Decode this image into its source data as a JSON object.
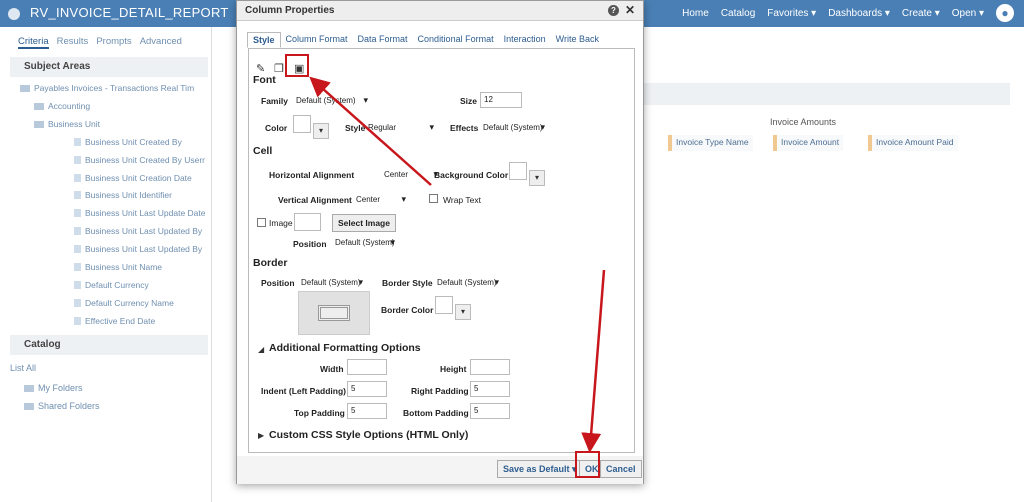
{
  "app": {
    "title": "RV_INVOICE_DETAIL_REPORT"
  },
  "topnav": [
    "Home",
    "Catalog",
    "Favorites ▾",
    "Dashboards ▾",
    "Create ▾",
    "Open ▾"
  ],
  "left": {
    "tabs": [
      "Criteria",
      "Results",
      "Prompts",
      "Advanced"
    ],
    "subject_areas_title": "Subject Areas",
    "root": "Payables Invoices - Transactions Real Tim",
    "folders": [
      "Accounting",
      "Business Unit"
    ],
    "columns": [
      "Business Unit Created By",
      "Business Unit Created By Usernam",
      "Business Unit Creation Date",
      "Business Unit Identifier",
      "Business Unit Last Update Date",
      "Business Unit Last Updated By",
      "Business Unit Last Updated By Use",
      "Business Unit Name",
      "Default Currency",
      "Default Currency Name",
      "Effective End Date"
    ],
    "catalog_title": "Catalog",
    "list_label": "List",
    "list_value": "All",
    "catalog_items": [
      "My Folders",
      "Shared Folders"
    ]
  },
  "workspace": {
    "group_header": "Invoice Amounts",
    "chips": [
      "Invoice Type Name",
      "Invoice Amount",
      "Invoice Amount Paid"
    ]
  },
  "dialog": {
    "title": "Column Properties",
    "tabs": [
      "Style",
      "Column Format",
      "Data Format",
      "Conditional Format",
      "Interaction",
      "Write Back"
    ],
    "font": {
      "section": "Font",
      "family_label": "Family",
      "family_value": "Default (System)",
      "size_label": "Size",
      "size_value": "12",
      "color_label": "Color",
      "style_label": "Style",
      "style_value": "Regular",
      "effects_label": "Effects",
      "effects_value": "Default (System)"
    },
    "cell": {
      "section": "Cell",
      "halign_label": "Horizontal Alignment",
      "halign_value": "Center",
      "bg_label": "Background Color",
      "valign_label": "Vertical Alignment",
      "valign_value": "Center",
      "wrap_label": "Wrap Text",
      "image_label": "Image",
      "select_image": "Select Image",
      "position_label": "Position",
      "position_value": "Default (System)"
    },
    "border": {
      "section": "Border",
      "position_label": "Position",
      "position_value": "Default (System)",
      "style_label": "Border Style",
      "style_value": "Default (System)",
      "color_label": "Border Color"
    },
    "additional": {
      "section": "Additional Formatting Options",
      "width_label": "Width",
      "height_label": "Height",
      "indent_label": "Indent (Left Padding)",
      "indent_value": "5",
      "right_label": "Right Padding",
      "right_value": "5",
      "top_label": "Top Padding",
      "top_value": "5",
      "bottom_label": "Bottom Padding",
      "bottom_value": "5"
    },
    "css_section": "Custom CSS Style Options (HTML Only)",
    "save_default": "Save as Default ▾",
    "ok": "OK",
    "cancel": "Cancel"
  },
  "colors": {
    "header": "#4a7fb5",
    "highlight": "#c8171c",
    "link": "#2d5d90"
  }
}
